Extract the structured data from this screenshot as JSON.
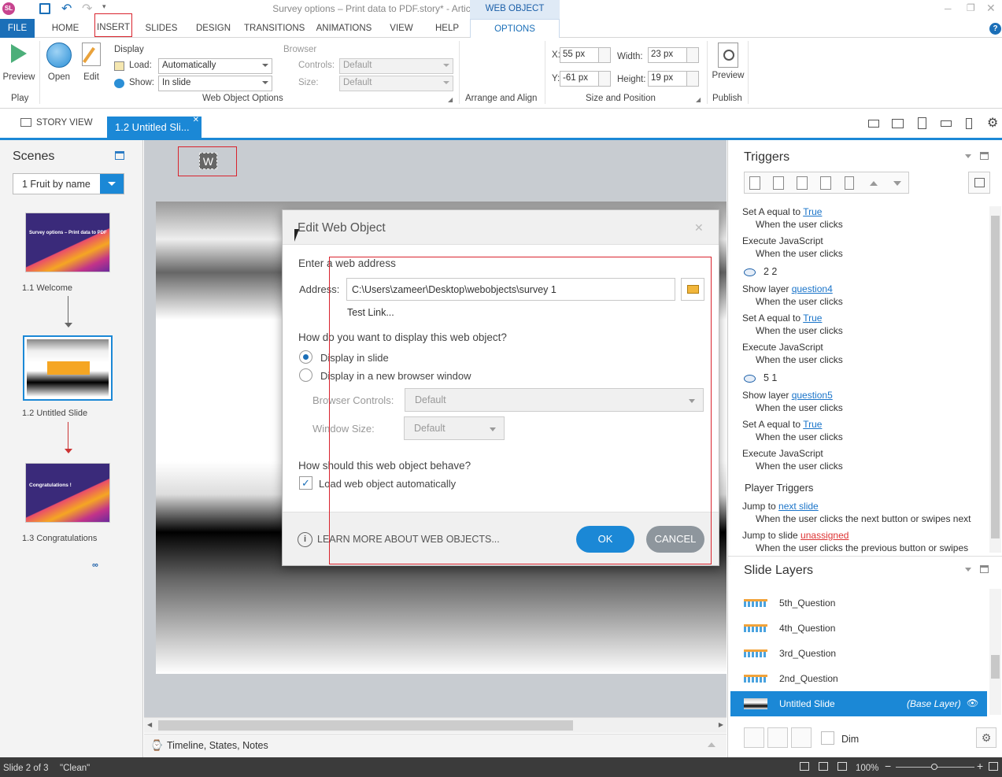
{
  "window": {
    "title": "Survey options – Print data to PDF.story* - Articulate Storyline",
    "app_icon": "SL"
  },
  "ribbon_tabs": [
    "FILE",
    "HOME",
    "INSERT",
    "SLIDES",
    "DESIGN",
    "TRANSITIONS",
    "ANIMATIONS",
    "VIEW",
    "HELP"
  ],
  "contextual": {
    "group": "WEB OBJECT TOOLS",
    "tab": "OPTIONS"
  },
  "ribbon": {
    "play": {
      "preview": "Preview",
      "group": "Play"
    },
    "open": "Open",
    "edit": "Edit",
    "display": {
      "label": "Display",
      "load_label": "Load:",
      "load_value": "Automatically",
      "show_label": "Show:",
      "show_value": "In slide"
    },
    "browser": {
      "label": "Browser",
      "controls_label": "Controls:",
      "controls_value": "Default",
      "size_label": "Size:",
      "size_value": "Default"
    },
    "wo_group": "Web Object Options",
    "arrange_group": "Arrange and Align",
    "size": {
      "x_label": "X:",
      "x": "55 px",
      "y_label": "Y:",
      "y": "-61 px",
      "w_label": "Width:",
      "w": "23 px",
      "h_label": "Height:",
      "h": "19 px",
      "group": "Size and Position"
    },
    "publish": {
      "preview": "Preview",
      "group": "Publish"
    }
  },
  "doc_tabs": {
    "story_view": "STORY VIEW",
    "active": "1.2 Untitled Sli..."
  },
  "scenes": {
    "title": "Scenes",
    "dropdown": "1 Fruit by name",
    "slides": [
      {
        "label": "1.1 Welcome",
        "thumb_text": "Survey options – Print data to PDF"
      },
      {
        "label": "1.2 Untitled Slide"
      },
      {
        "label": "1.3 Congratulations",
        "thumb_text": "Congratulations !"
      }
    ]
  },
  "web_object_placeholder": "W",
  "dialog": {
    "title": "Edit Web Object",
    "enter_label": "Enter a web address",
    "address_label": "Address:",
    "address_value": "C:\\Users\\zameer\\Desktop\\webobjects\\survey 1",
    "test_link": "Test Link...",
    "display_q": "How do you want to display this web object?",
    "opt_slide": "Display in slide",
    "opt_window": "Display in a new browser window",
    "browser_controls_label": "Browser Controls:",
    "browser_controls_value": "Default",
    "window_size_label": "Window Size:",
    "window_size_value": "Default",
    "behave_q": "How should this web object behave?",
    "load_auto": "Load web object automatically",
    "learn_more": "LEARN MORE ABOUT WEB OBJECTS...",
    "ok": "OK",
    "cancel": "CANCEL"
  },
  "triggers": {
    "title": "Triggers",
    "items": [
      {
        "pre": "Set A equal to ",
        "link": "True"
      },
      {
        "sub": "When the user clicks"
      },
      {
        "pre": "Execute JavaScript"
      },
      {
        "sub": "When the user clicks"
      },
      {
        "head": "2 2"
      },
      {
        "pre": "Show layer ",
        "link": "question4"
      },
      {
        "sub": "When the user clicks"
      },
      {
        "pre": "Set A equal to ",
        "link": "True"
      },
      {
        "sub": "When the user clicks"
      },
      {
        "pre": "Execute JavaScript"
      },
      {
        "sub": "When the user clicks"
      },
      {
        "head": "5 1"
      },
      {
        "pre": "Show layer ",
        "link": "question5"
      },
      {
        "sub": "When the user clicks"
      },
      {
        "pre": "Set A equal to ",
        "link": "True"
      },
      {
        "sub": "When the user clicks"
      },
      {
        "pre": "Execute JavaScript"
      },
      {
        "sub": "When the user clicks"
      }
    ],
    "player_title": "Player Triggers",
    "player": [
      {
        "pre": "Jump to ",
        "link": "next slide"
      },
      {
        "sub": "When the user clicks the next button or swipes next"
      },
      {
        "pre": "Jump to slide ",
        "link": "unassigned"
      },
      {
        "sub": "When the user clicks the previous button or swipes"
      }
    ]
  },
  "layers": {
    "title": "Slide Layers",
    "items": [
      "5th_Question",
      "4th_Question",
      "3rd_Question",
      "2nd_Question"
    ],
    "base": {
      "name": "Untitled Slide",
      "tag": "(Base Layer)"
    },
    "dim": "Dim"
  },
  "timeline": "Timeline, States, Notes",
  "status": {
    "slide": "Slide 2 of 3",
    "state": "\"Clean\"",
    "zoom": "100%"
  }
}
